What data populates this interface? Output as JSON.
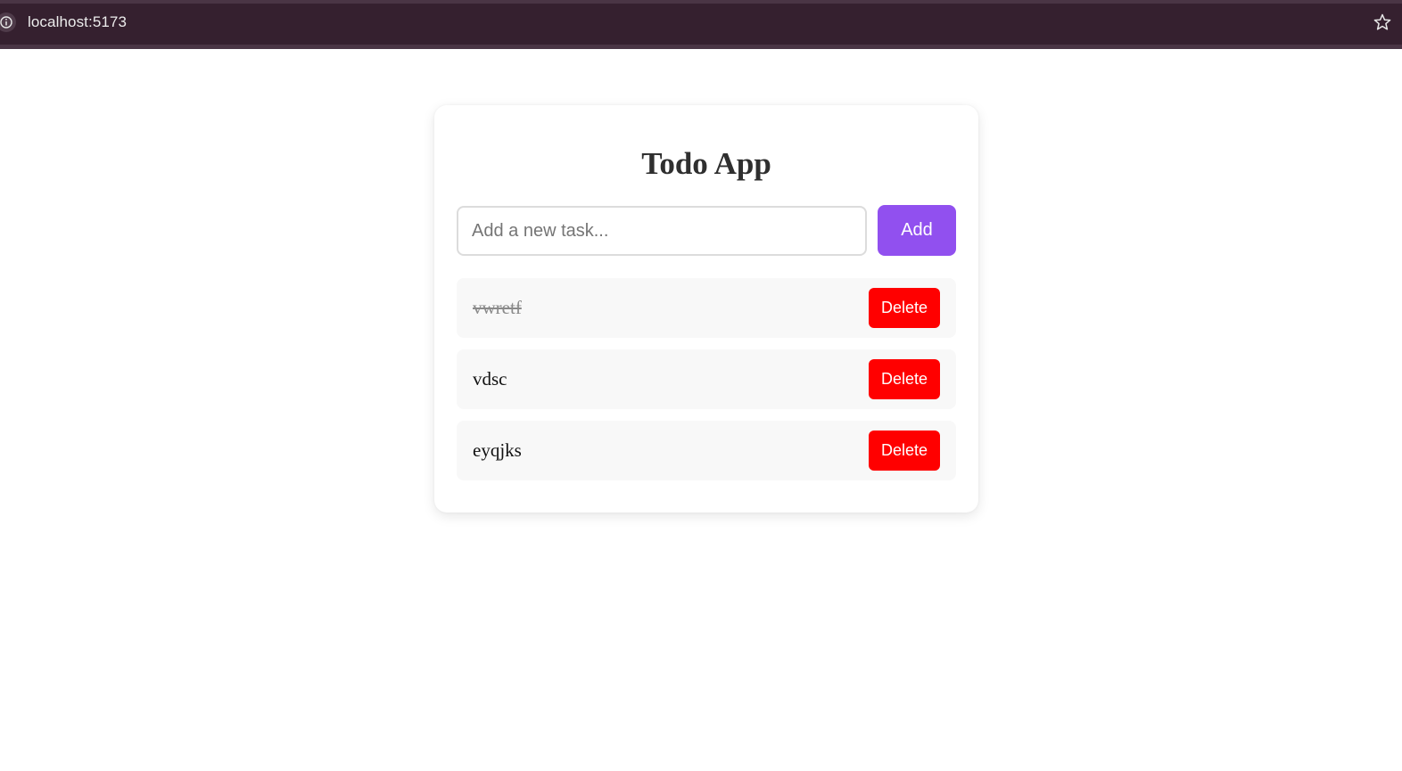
{
  "browser": {
    "url": "localhost:5173",
    "site_info_icon": "info-icon",
    "bookmark_icon": "star-icon"
  },
  "app": {
    "title": "Todo App",
    "input": {
      "value": "",
      "placeholder": "Add a new task..."
    },
    "add_label": "Add",
    "accent_color": "#9150ef",
    "delete_color": "#ff0000",
    "todos": [
      {
        "text": "vwretf",
        "completed": true,
        "delete_label": "Delete"
      },
      {
        "text": "vdsc",
        "completed": false,
        "delete_label": "Delete"
      },
      {
        "text": "eyqjks",
        "completed": false,
        "delete_label": "Delete"
      }
    ]
  }
}
